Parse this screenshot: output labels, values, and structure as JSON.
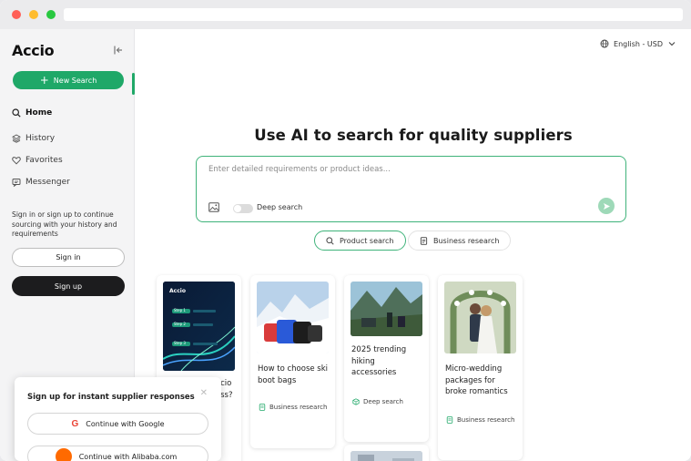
{
  "app": {
    "logo": "Accio",
    "new_search": "New Search"
  },
  "sidebar": {
    "items": [
      {
        "label": "Home",
        "icon": "search-icon",
        "active": true
      },
      {
        "label": "History",
        "icon": "layers-icon"
      },
      {
        "label": "Favorites",
        "icon": "heart-icon"
      },
      {
        "label": "Messenger",
        "icon": "chat-icon"
      }
    ],
    "signin_message": "Sign in or sign up to continue sourcing with your history and requirements",
    "sign_in": "Sign in",
    "sign_up": "Sign up"
  },
  "header": {
    "language": "English - USD"
  },
  "main": {
    "headline": "Use AI to search for quality suppliers",
    "search_placeholder": "Enter detailed requirements or product ideas...",
    "deep_search": "Deep search",
    "modes": [
      "Product search",
      "Business research"
    ]
  },
  "cards": [
    {
      "title": "...cio ...ss?",
      "tag": ""
    },
    {
      "title": "How to choose ski boot bags",
      "tag": "Business research"
    },
    {
      "title": "2025 trending hiking accessories",
      "tag": "Deep search"
    },
    {
      "title": "Micro-wedding packages for broke romantics",
      "tag": "Business research"
    }
  ],
  "card1_thumb": {
    "brand": "Accio",
    "steps": [
      "Step 1",
      "Step 2",
      "Step 3"
    ]
  },
  "popup": {
    "title": "Sign up for instant supplier responses",
    "google": "Continue with Google",
    "alibaba": "Continue with Alibaba.com"
  },
  "colors": {
    "accent": "#1fa868",
    "dark_button": "#1c1c1e"
  }
}
